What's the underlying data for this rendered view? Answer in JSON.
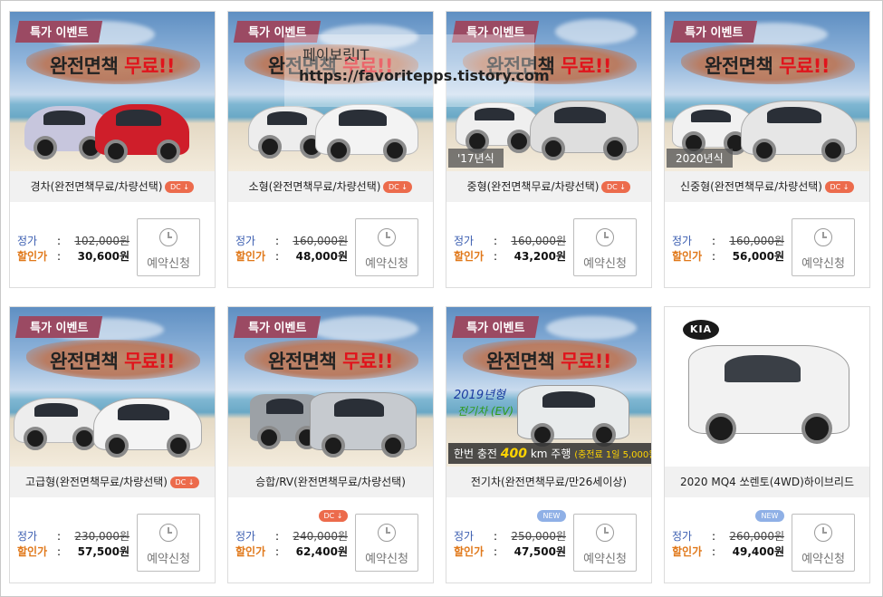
{
  "labels": {
    "orig_label": "정가",
    "sale_label": "할인가",
    "colon": ":",
    "reserve": "예약신청",
    "event_badge": "특가 이벤트",
    "headline_black": "완전면책 ",
    "headline_red": "무료!!",
    "dc_badge": "DC ↓",
    "new_badge": "NEW"
  },
  "watermark": {
    "line1": "페이보릿IT",
    "line2": "https://favoritepps.tistory.com"
  },
  "cars": [
    {
      "title": "경차(완전면책무료/차량선택)",
      "orig": "102,000원",
      "sale": "30,600원",
      "year": "",
      "body_color": "#c9c9dd",
      "body_color2": "#d21f2b"
    },
    {
      "title": "소형(완전면책무료/차량선택)",
      "orig": "160,000원",
      "sale": "48,000원",
      "year": "",
      "body_color": "#ececec",
      "body_color2": "#f2f2f2"
    },
    {
      "title": "중형(완전면책무료/차량선택)",
      "orig": "160,000원",
      "sale": "43,200원",
      "year": "'17년식",
      "body_color": "#ededed",
      "body_color2": "#dcdcdc"
    },
    {
      "title": "신중형(완전면책무료/차량선택)",
      "orig": "160,000원",
      "sale": "56,000원",
      "year": "2020년식",
      "body_color": "#f0f0f0",
      "body_color2": "#e6e6e6"
    },
    {
      "title": "고급형(완전면책무료/차량선택)",
      "orig": "230,000원",
      "sale": "57,500원",
      "year": "",
      "body_color": "#eeeeee",
      "body_color2": "#f4f4f4"
    },
    {
      "title": "승합/RV(완전면책무료/차량선택)",
      "orig": "240,000원",
      "sale": "62,400원",
      "year": "",
      "body_color": "#9aa0a6",
      "body_color2": "#c7cbd0"
    },
    {
      "title": "전기차(완전면책무료/만26세이상)",
      "orig": "250,000원",
      "sale": "47,500원",
      "year": "",
      "body_color": "#e9eced",
      "body_color2": "#e9eced"
    },
    {
      "title": "2020 MQ4 쏘렌토(4WD)하이브리드",
      "orig": "260,000원",
      "sale": "49,400원",
      "year": "",
      "body_color": "#f4f4f4",
      "body_color2": "#f4f4f4"
    }
  ],
  "ev": {
    "year_hand": "2019년형",
    "type_hand": "전기차 (EV)",
    "caption_a": "한번 충전 ",
    "caption_big": "400",
    "caption_b": " km 주행 ",
    "caption_small": "(충전료 1일 5,000원)"
  },
  "kia_logo": "KIA"
}
